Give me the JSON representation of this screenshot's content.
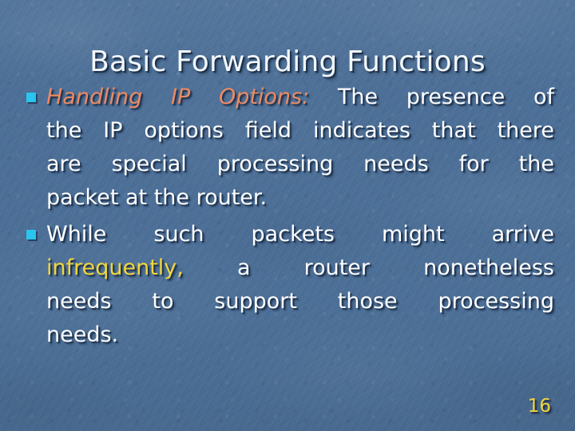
{
  "slide": {
    "title": "Basic Forwarding Functions",
    "page_number": "16",
    "background_color": "#4d7098",
    "title_color": "#f2f7fb",
    "body_color": "#ffffff",
    "bullet_marker_color": "#29c4ef",
    "accent_orange": "#ec8a62",
    "accent_yellow": "#f2d63c",
    "page_number_color": "#f2d63c"
  },
  "bullets": [
    {
      "marker": "square-bullet",
      "lead_emphasis": "Handling IP Options:",
      "lead_emphasis_color": "#ec8a62",
      "text": "The presence of the IP options field indicates that there are special processing needs for the packet at the router.",
      "lines": [
        "The presence of",
        "the IP options field indicates that there",
        "are special processing needs for the",
        "packet at the router."
      ]
    },
    {
      "marker": "square-bullet",
      "text_before_emphasis": "While such packets might arrive",
      "emphasis": "infrequently,",
      "emphasis_color": "#f2d63c",
      "text_after_emphasis": "a router nonetheless needs to support those processing needs.",
      "lines": [
        "While such packets might arrive",
        "a router nonetheless",
        "needs to support those processing",
        "needs."
      ]
    }
  ]
}
